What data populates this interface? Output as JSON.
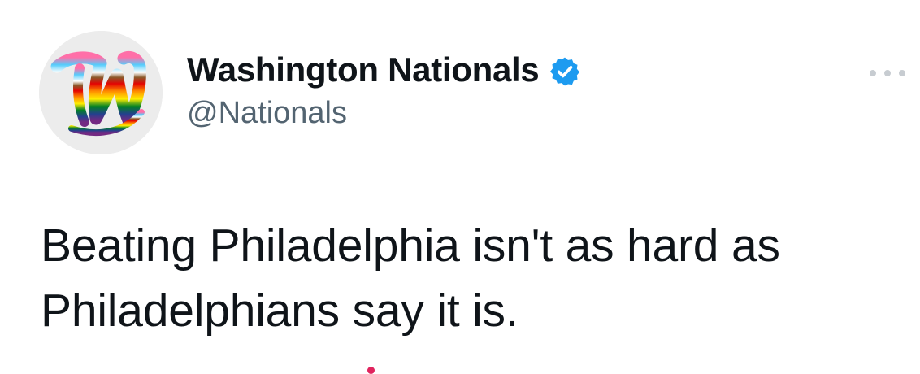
{
  "author": {
    "display_name": "Washington Nationals",
    "handle": "@Nationals",
    "verified": true,
    "avatar_icon": "nationals-rainbow-w-logo",
    "avatar_bg": "#ececec"
  },
  "tweet": {
    "text_lines": [
      "Beating Philadelphia isn't as hard as",
      "Philadelphians say it is."
    ]
  },
  "icons": {
    "verified": "verified-badge-icon",
    "more": "more-options-icon"
  },
  "colors": {
    "text_primary": "#0f1419",
    "text_secondary": "#536471",
    "verified_blue": "#1d9bf0",
    "menu_dots": "#c7ccd1"
  }
}
